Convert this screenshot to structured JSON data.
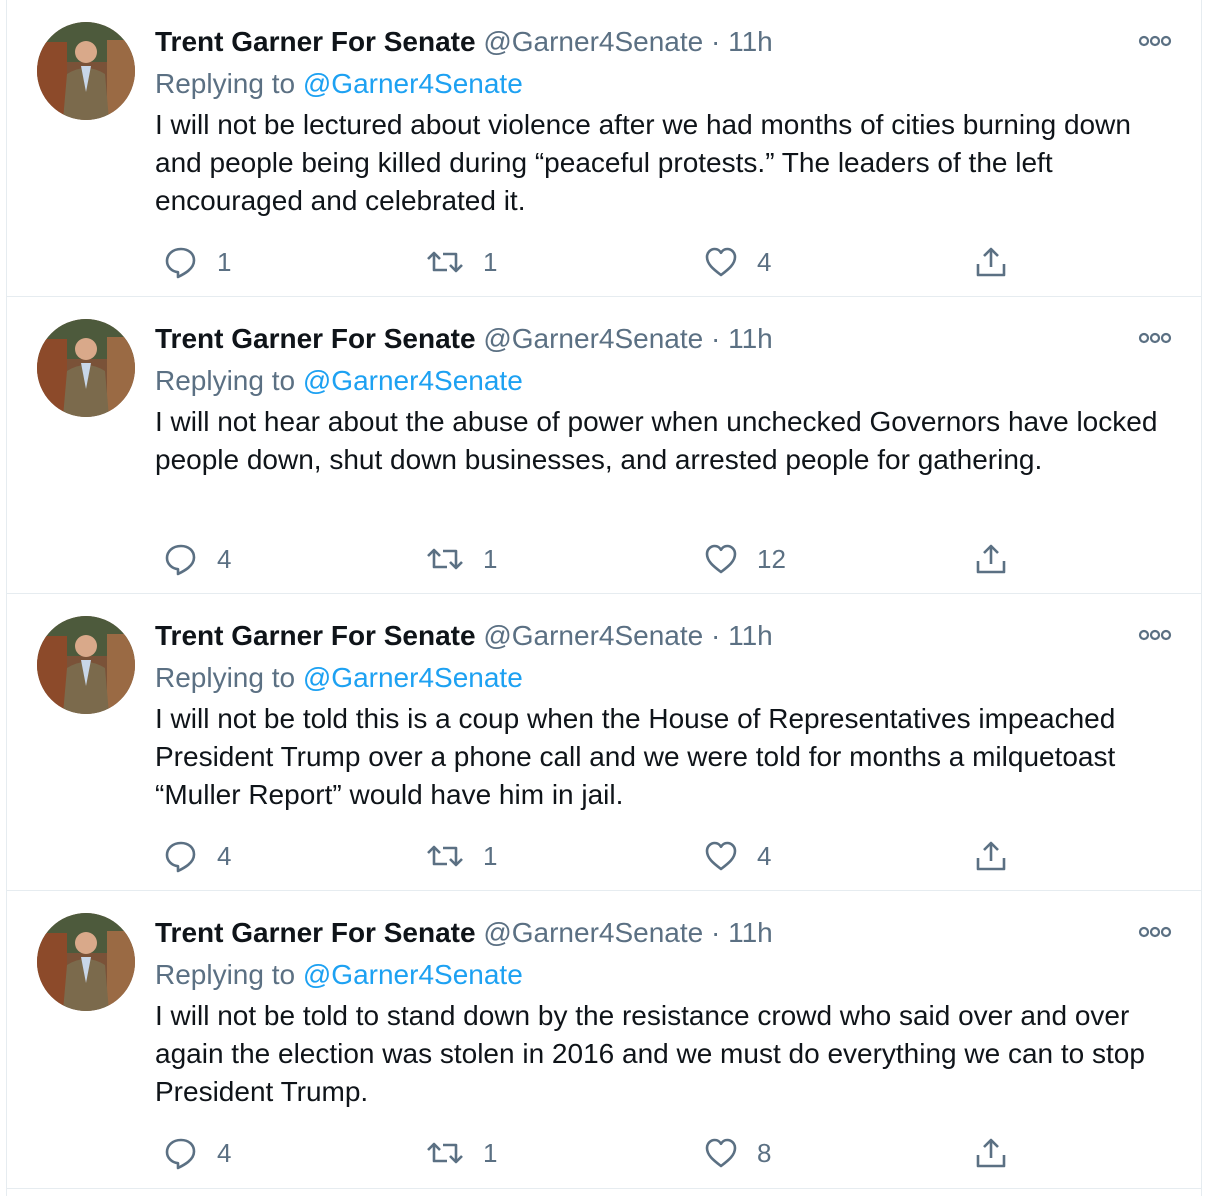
{
  "tweets": [
    {
      "name": "Trent Garner For Senate",
      "handle": "@Garner4Senate",
      "separator": "·",
      "time": "11h",
      "replying_prefix": "Replying to",
      "replying_to": "@Garner4Senate",
      "text": "I will not be lectured about violence after we had months of cities burning down and people being killed during “peaceful protests.” The leaders of the left encouraged and celebrated it.",
      "replies": "1",
      "retweets": "1",
      "likes": "4"
    },
    {
      "name": "Trent Garner For Senate",
      "handle": "@Garner4Senate",
      "separator": "·",
      "time": "11h",
      "replying_prefix": "Replying to",
      "replying_to": "@Garner4Senate",
      "text": "I will not hear about the abuse of power when unchecked Governors have locked people down, shut down businesses, and arrested people for gathering.",
      "replies": "4",
      "retweets": "1",
      "likes": "12"
    },
    {
      "name": "Trent Garner For Senate",
      "handle": "@Garner4Senate",
      "separator": "·",
      "time": "11h",
      "replying_prefix": "Replying to",
      "replying_to": "@Garner4Senate",
      "text": "I will not be told this is a coup when the House of Representatives impeached President Trump over a phone call and we were told for months a milquetoast “Muller Report” would have him in jail.",
      "replies": "4",
      "retweets": "1",
      "likes": "4"
    },
    {
      "name": "Trent Garner For Senate",
      "handle": "@Garner4Senate",
      "separator": "·",
      "time": "11h",
      "replying_prefix": "Replying to",
      "replying_to": "@Garner4Senate",
      "text": "I will not be told to stand down by the resistance crowd who said over and over again the election was stolen in 2016 and we must do everything we can to stop President Trump.",
      "replies": "4",
      "retweets": "1",
      "likes": "8"
    }
  ],
  "colors": {
    "text": "#0f1419",
    "secondary": "#5b7083",
    "link": "#1da1f2",
    "divider": "#e6ecf0"
  },
  "icons": [
    "more-icon",
    "reply-icon",
    "retweet-icon",
    "like-icon",
    "share-icon"
  ]
}
